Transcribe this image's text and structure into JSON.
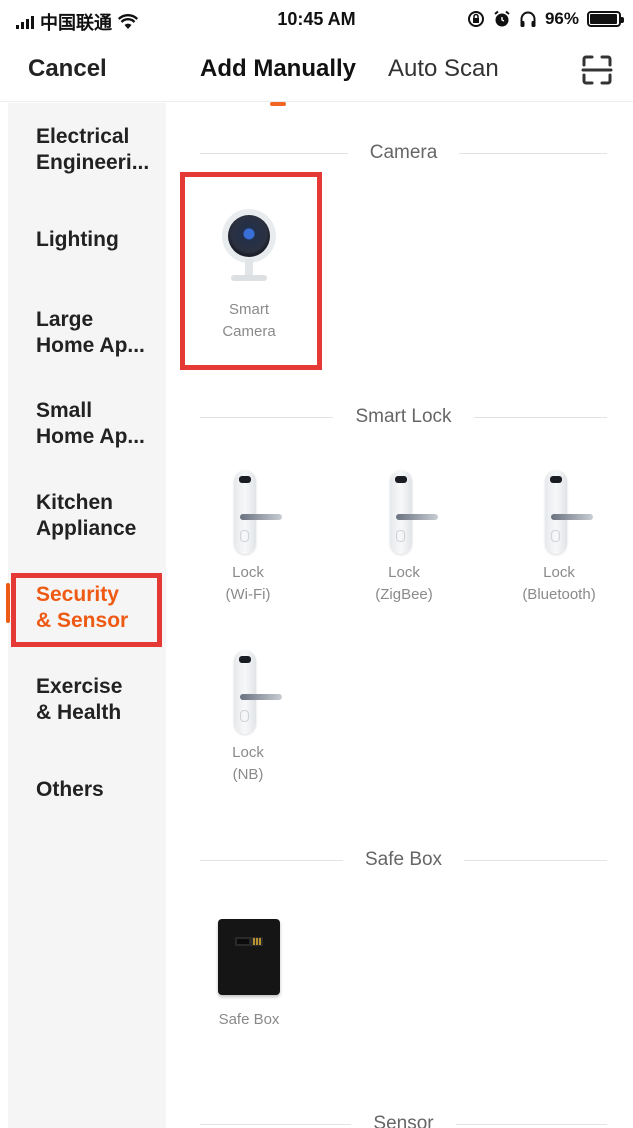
{
  "status_bar": {
    "carrier": "中国联通",
    "time": "10:45 AM",
    "battery": "96%",
    "battery_level": 0.96
  },
  "nav": {
    "cancel_label": "Cancel",
    "tabs": [
      {
        "label": "Add Manually",
        "active": true
      },
      {
        "label": "Auto Scan",
        "active": false
      }
    ],
    "accent_color": "#f26522"
  },
  "sidebar": {
    "items": [
      {
        "label": "Electrical\nEngineeri..."
      },
      {
        "label": "Lighting"
      },
      {
        "label": "Large\nHome Ap..."
      },
      {
        "label": "Small\nHome Ap..."
      },
      {
        "label": "Kitchen\nAppliance"
      },
      {
        "label": "Security\n& Sensor",
        "active": true
      },
      {
        "label": "Exercise\n& Health"
      },
      {
        "label": "Others"
      }
    ],
    "active_color": "#ee5a14"
  },
  "sections": [
    {
      "title": "Camera",
      "devices": [
        {
          "name": "Smart\nCamera",
          "icon": "camera-icon"
        }
      ]
    },
    {
      "title": "Smart Lock",
      "devices": [
        {
          "name": "Lock\n(Wi-Fi)",
          "icon": "door-lock-icon"
        },
        {
          "name": "Lock\n(ZigBee)",
          "icon": "door-lock-icon"
        },
        {
          "name": "Lock\n(Bluetooth)",
          "icon": "door-lock-icon"
        },
        {
          "name": "Lock\n(NB)",
          "icon": "door-lock-icon"
        }
      ]
    },
    {
      "title": "Safe Box",
      "devices": [
        {
          "name": "Safe Box",
          "icon": "safe-box-icon"
        }
      ]
    },
    {
      "title": "Sensor",
      "devices": []
    }
  ],
  "highlight_color": "#e53935"
}
